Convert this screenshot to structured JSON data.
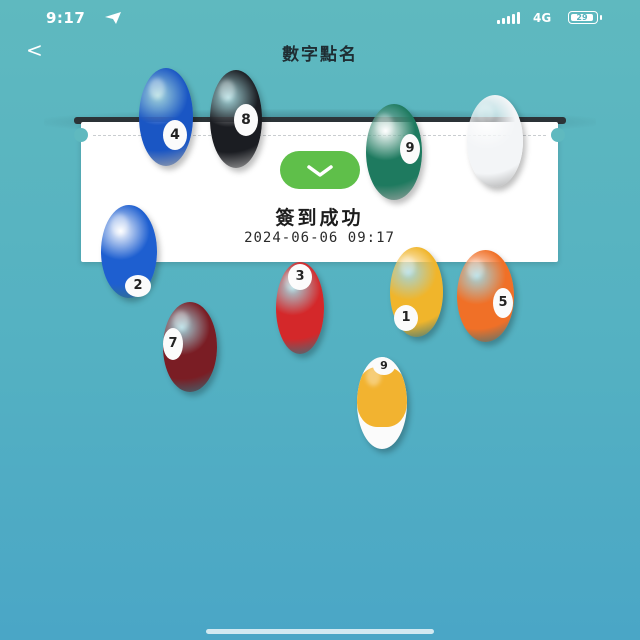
{
  "status_bar": {
    "time": "9:17",
    "network": "4G",
    "battery": "29"
  },
  "nav": {
    "back_label": "<",
    "title": "數字點名"
  },
  "result": {
    "message": "簽到成功",
    "timestamp": "2024-06-06 09:17"
  },
  "balls": [
    {
      "number": "4",
      "color": "#1a56c4",
      "striped": false
    },
    {
      "number": "8",
      "color": "#1b1d22",
      "striped": false
    },
    {
      "number": "9",
      "color": "#1e7a5f",
      "striped": false
    },
    {
      "number": "",
      "color": "#f3f5f7",
      "striped": false
    },
    {
      "number": "2",
      "color": "#1e5fd0",
      "striped": false
    },
    {
      "number": "3",
      "color": "#d4282a",
      "striped": false
    },
    {
      "number": "1",
      "color": "#f0b52b",
      "striped": false
    },
    {
      "number": "5",
      "color": "#f07027",
      "striped": false
    },
    {
      "number": "7",
      "color": "#7a1d24",
      "striped": false
    },
    {
      "number": "9",
      "color": "#f2b330",
      "striped": true
    }
  ]
}
